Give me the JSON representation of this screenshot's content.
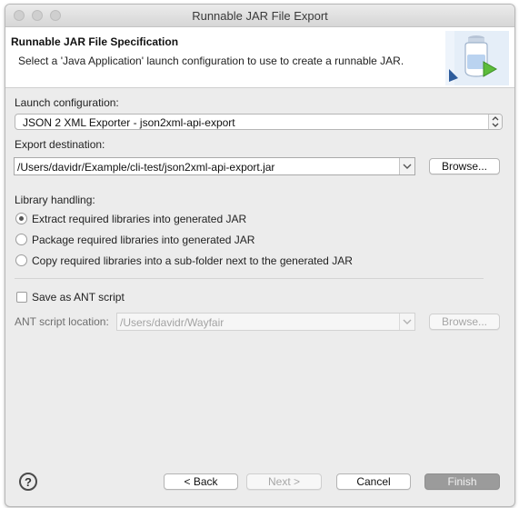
{
  "window": {
    "title": "Runnable JAR File Export"
  },
  "header": {
    "title": "Runnable JAR File Specification",
    "description": "Select a 'Java Application' launch configuration to use to create a runnable JAR.",
    "banner_icon": "jar-export-wizard-icon"
  },
  "launch": {
    "label": "Launch configuration:",
    "value": "JSON 2 XML Exporter - json2xml-api-export"
  },
  "export": {
    "label": "Export destination:",
    "value": "/Users/davidr/Example/cli-test/json2xml-api-export.jar",
    "browse_label": "Browse..."
  },
  "library": {
    "label": "Library handling:",
    "options": [
      {
        "label": "Extract required libraries into generated JAR",
        "checked": true
      },
      {
        "label": "Package required libraries into generated JAR",
        "checked": false
      },
      {
        "label": "Copy required libraries into a sub-folder next to the generated JAR",
        "checked": false
      }
    ]
  },
  "ant": {
    "save_label": "Save as ANT script",
    "save_checked": false,
    "location_label": "ANT script location:",
    "location_value": "/Users/davidr/Wayfair",
    "browse_label": "Browse..."
  },
  "footer": {
    "help_symbol": "?",
    "back_label": "< Back",
    "next_label": "Next >",
    "cancel_label": "Cancel",
    "finish_label": "Finish"
  },
  "colors": {
    "window_bg": "#ececec",
    "header_bg": "#ffffff",
    "finish_button_bg": "#9b9b9b"
  }
}
